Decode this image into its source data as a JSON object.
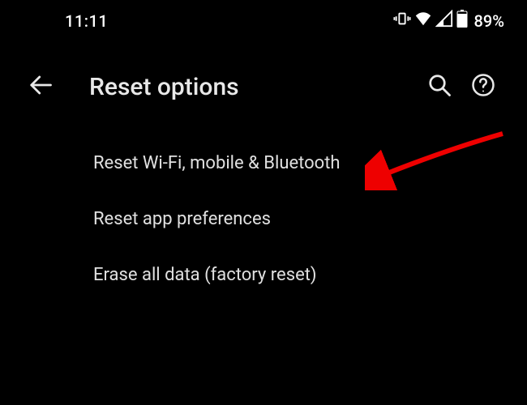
{
  "status_bar": {
    "time": "11:11",
    "battery_percent": "89%"
  },
  "header": {
    "title": "Reset options"
  },
  "options": [
    {
      "label": "Reset Wi-Fi, mobile & Bluetooth"
    },
    {
      "label": "Reset app preferences"
    },
    {
      "label": "Erase all data (factory reset)"
    }
  ]
}
